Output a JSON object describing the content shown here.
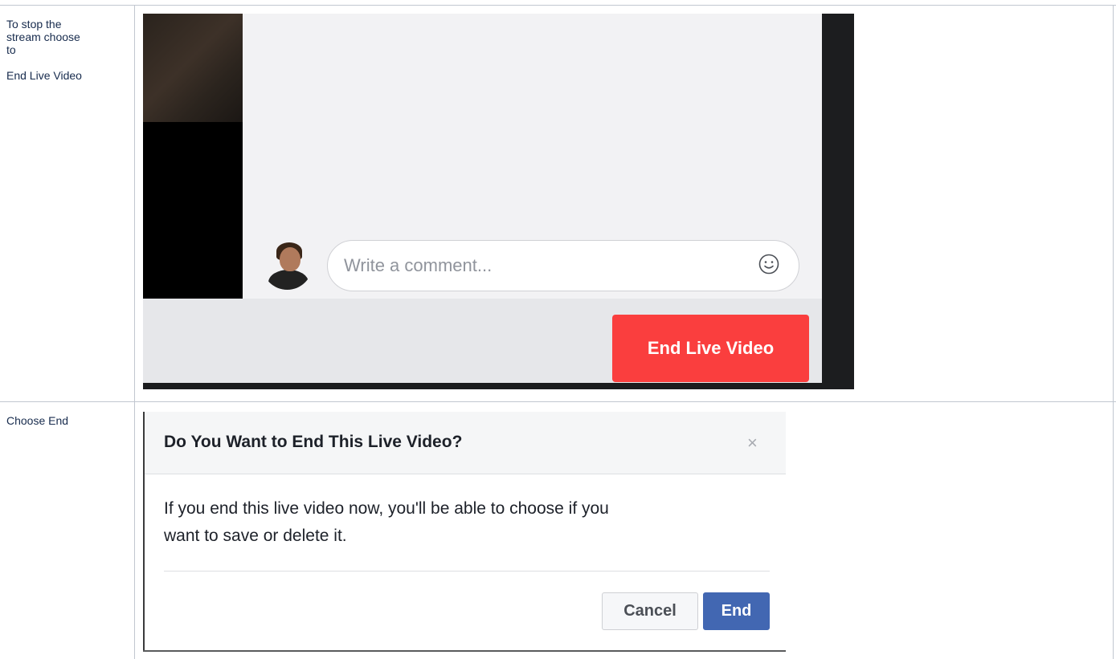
{
  "rows": [
    {
      "label_lines": [
        "To stop the",
        "stream choose",
        "to"
      ],
      "label_extra": "End Live Video",
      "screenshot": {
        "comment_placeholder": "Write a comment...",
        "end_live_button": "End Live Video",
        "end_live_color": "#fa3e3e"
      }
    },
    {
      "label": "Choose End",
      "dialog": {
        "title": "Do You Want to End This Live Video?",
        "close_symbol": "×",
        "body": "If you end this live video now, you'll be able to choose if you want to save or delete it.",
        "cancel_label": "Cancel",
        "end_label": "End",
        "end_color": "#4267b2"
      }
    }
  ]
}
